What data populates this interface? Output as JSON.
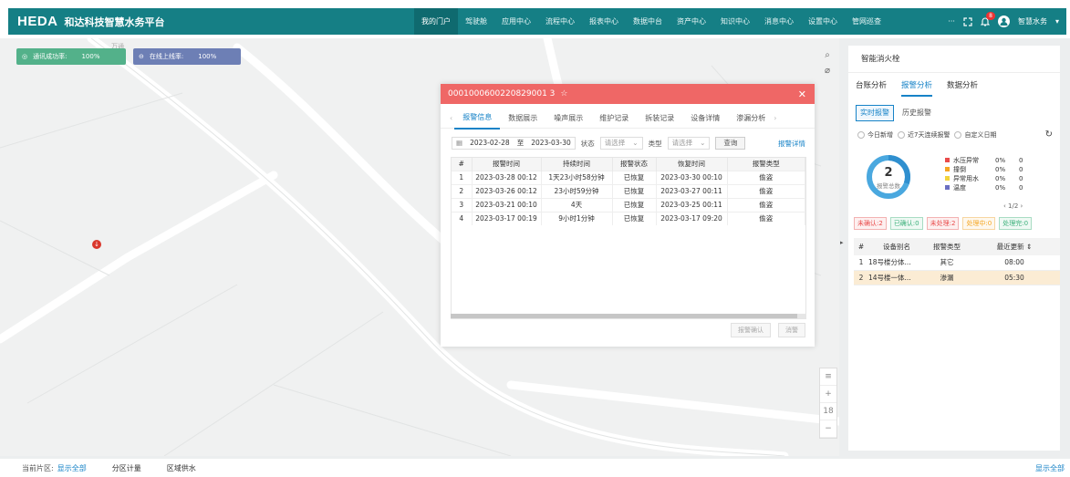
{
  "header": {
    "brand": "HEDA",
    "brand_cn": "和达科技智慧水务平台",
    "nav": [
      "我的门户",
      "驾驶舱",
      "应用中心",
      "流程中心",
      "报表中心",
      "数据中台",
      "资产中心",
      "知识中心",
      "消息中心",
      "设置中心",
      "管网巡查"
    ],
    "more": "···",
    "notify_count": "8",
    "user": "智慧水务"
  },
  "map": {
    "stat_online_label": "通讯成功率:",
    "stat_online_value": "100%",
    "stat_onboard_label": "在线上线率:",
    "stat_onboard_value": "100%",
    "zoom_level": "18",
    "map_label": "万通"
  },
  "dialog": {
    "title": "0001000600220829001 3",
    "star": "☆",
    "tabs": [
      "报警信息",
      "数据展示",
      "噪声展示",
      "维护记录",
      "拆装记录",
      "设备详情",
      "渗漏分析"
    ],
    "date_start": "2023-02-28",
    "date_sep": "至",
    "date_end": "2023-03-30",
    "status_label": "状态",
    "status_placeholder": "请选择",
    "type_label": "类型",
    "type_placeholder": "请选择",
    "query": "查询",
    "detail": "报警详情",
    "columns": [
      "#",
      "报警时间",
      "持续时间",
      "报警状态",
      "恢复时间",
      "报警类型"
    ],
    "rows": [
      [
        "1",
        "2023-03-28 00:12",
        "1天23小时58分钟",
        "已恢复",
        "2023-03-30 00:10",
        "偷盗"
      ],
      [
        "2",
        "2023-03-26 00:12",
        "23小时59分钟",
        "已恢复",
        "2023-03-27 00:11",
        "偷盗"
      ],
      [
        "3",
        "2023-03-21 00:10",
        "4天",
        "已恢复",
        "2023-03-25 00:11",
        "偷盗"
      ],
      [
        "4",
        "2023-03-17 00:19",
        "9小时1分钟",
        "已恢复",
        "2023-03-17 09:20",
        "偷盗"
      ]
    ],
    "btn_confirm": "报警确认",
    "btn_handle": "消警"
  },
  "panel": {
    "title": "智能消火栓",
    "tabs": [
      "台账分析",
      "报警分析",
      "数据分析"
    ],
    "subtabs": [
      "实时报警",
      "历史报警"
    ],
    "radios": [
      "今日新增",
      "近7天连续报警",
      "自定义日期"
    ],
    "total": "2",
    "total_label": "报警总数",
    "legend": [
      {
        "name": "水压异常",
        "pct": "0%",
        "count": "0",
        "color": "#e94b4b"
      },
      {
        "name": "撞倒",
        "pct": "0%",
        "count": "0",
        "color": "#f5a623"
      },
      {
        "name": "异常用水",
        "pct": "0%",
        "count": "0",
        "color": "#f3d43b"
      },
      {
        "name": "温度",
        "pct": "0%",
        "count": "0",
        "color": "#6b6fc2"
      }
    ],
    "pager": "‹ 1/2 ›",
    "tags": [
      {
        "text": "未确认:2",
        "color": "#e94b4b"
      },
      {
        "text": "已确认:0",
        "color": "#3bb07a"
      },
      {
        "text": "未处理:2",
        "color": "#e94b4b"
      },
      {
        "text": "处理中:0",
        "color": "#f5a623"
      },
      {
        "text": "处理完:0",
        "color": "#3bb07a"
      }
    ],
    "columns": [
      "#",
      "设备别名",
      "报警类型",
      "最近更新"
    ],
    "rows": [
      [
        "1",
        "18号楼分体...",
        "其它",
        "08:00"
      ],
      [
        "2",
        "14号楼一体...",
        "渗漏",
        "05:30"
      ]
    ]
  },
  "bottom": {
    "region_label": "当前片区:",
    "region_link": "显示全部",
    "tab1": "分区计量",
    "tab2": "区域供水",
    "show_all": "显示全部"
  }
}
